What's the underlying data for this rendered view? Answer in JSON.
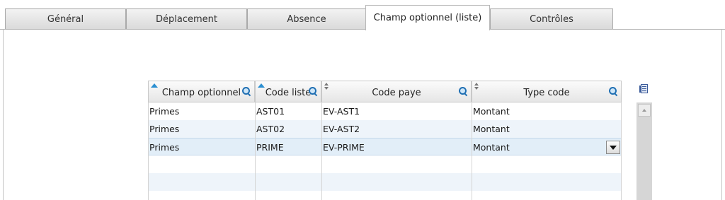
{
  "tabs": [
    {
      "label": "Général",
      "active": false
    },
    {
      "label": "Déplacement",
      "active": false
    },
    {
      "label": "Absence",
      "active": false
    },
    {
      "label": "Champ optionnel (liste)",
      "active": true
    },
    {
      "label": "Contrôles",
      "active": false
    }
  ],
  "grid": {
    "columns": [
      {
        "label": "Champ optionnel",
        "sort": "ascending",
        "search_icon": "search-icon"
      },
      {
        "label": "Code liste",
        "sort": "ascending",
        "search_icon": "search-icon"
      },
      {
        "label": "Code paye",
        "sort": "none",
        "search_icon": "search-icon"
      },
      {
        "label": "Type code",
        "sort": "none",
        "search_icon": "search-icon"
      }
    ],
    "rows": [
      {
        "champ": "Primes",
        "code_liste": "AST01",
        "code_paye": "EV-AST1",
        "type_code": "Montant"
      },
      {
        "champ": "Primes",
        "code_liste": "AST02",
        "code_paye": "EV-AST2",
        "type_code": "Montant"
      },
      {
        "champ": "Primes",
        "code_liste": "PRIME",
        "code_paye": "EV-PRIME",
        "type_code": "Montant",
        "selected": true
      }
    ],
    "export_icon": "export-list-icon",
    "dropdown_icon": "chevron-down-icon"
  },
  "colors": {
    "selected_row": "#e2eef8",
    "alt_row": "#eef4fa",
    "sort_arrow": "#2b8fd1",
    "search_icon": "#1f6fb3"
  }
}
